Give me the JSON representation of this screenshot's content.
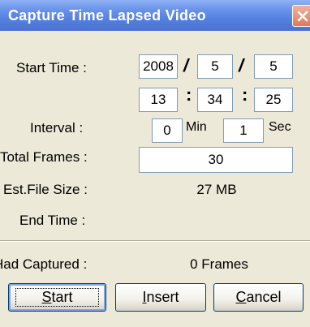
{
  "window": {
    "title": "Capture Time Lapsed Video",
    "close_icon": "close-icon"
  },
  "start_time": {
    "label": "Start Time :",
    "year": "2008",
    "month": "5",
    "day": "5",
    "hour": "13",
    "minute": "34",
    "second": "25",
    "date_separator": "/",
    "time_separator": ":"
  },
  "interval": {
    "label": "Interval :",
    "minutes": "0",
    "min_unit": "Min",
    "seconds": "1",
    "sec_unit": "Sec"
  },
  "total_frames": {
    "label": "Total Frames :",
    "value": "30"
  },
  "est_file_size": {
    "label": "Est.File Size :",
    "value": "27 MB"
  },
  "end_time": {
    "label": "End Time :",
    "value": ""
  },
  "had_captured": {
    "label": "Had Captured :",
    "value": "0 Frames"
  },
  "buttons": {
    "start": {
      "mnemonic": "S",
      "rest": "tart"
    },
    "insert": {
      "mnemonic": "I",
      "rest": "nsert"
    },
    "cancel": {
      "mnemonic": "C",
      "rest": "ancel"
    }
  },
  "colors": {
    "titlebar": "#5581e0",
    "dialog_background": "#ece9d8",
    "close_button": "#e0795a"
  }
}
